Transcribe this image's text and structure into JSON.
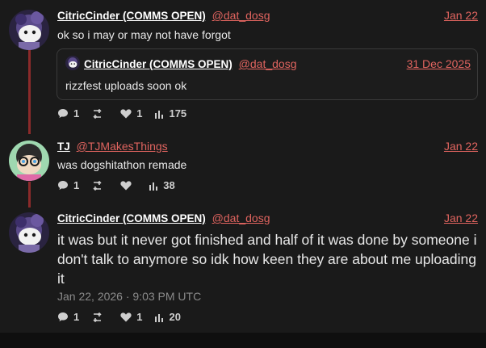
{
  "posts": [
    {
      "name": "CitricCinder (COMMS OPEN)",
      "handle": "@dat_dosg",
      "date": "Jan 22",
      "text": "ok so i may or may not have forgot",
      "quote": {
        "name": "CitricCinder (COMMS OPEN)",
        "handle": "@dat_dosg",
        "date": "31 Dec 2025",
        "text": "rizzfest uploads soon ok"
      },
      "replies": "1",
      "likes": "1",
      "views": "175"
    },
    {
      "name": "TJ",
      "handle": "@TJMakesThings",
      "date": "Jan 22",
      "text": "was dogshitathon remade",
      "replies": "1",
      "views": "38"
    },
    {
      "name": "CitricCinder (COMMS OPEN)",
      "handle": "@dat_dosg",
      "date": "Jan 22",
      "text": "it was but it never got finished and half of it was done by someone i don't talk to anymore so idk how keen they are about me uploading it",
      "timestamp": "Jan 22, 2026 · 9:03 PM UTC",
      "replies": "1",
      "likes": "1",
      "views": "20"
    }
  ],
  "colors": {
    "accent": "#e0645f",
    "thread_line": "#8b2a2a",
    "background": "#1a1a1a"
  },
  "icons": [
    "reply-icon",
    "retweet-icon",
    "heart-icon",
    "views-icon"
  ]
}
